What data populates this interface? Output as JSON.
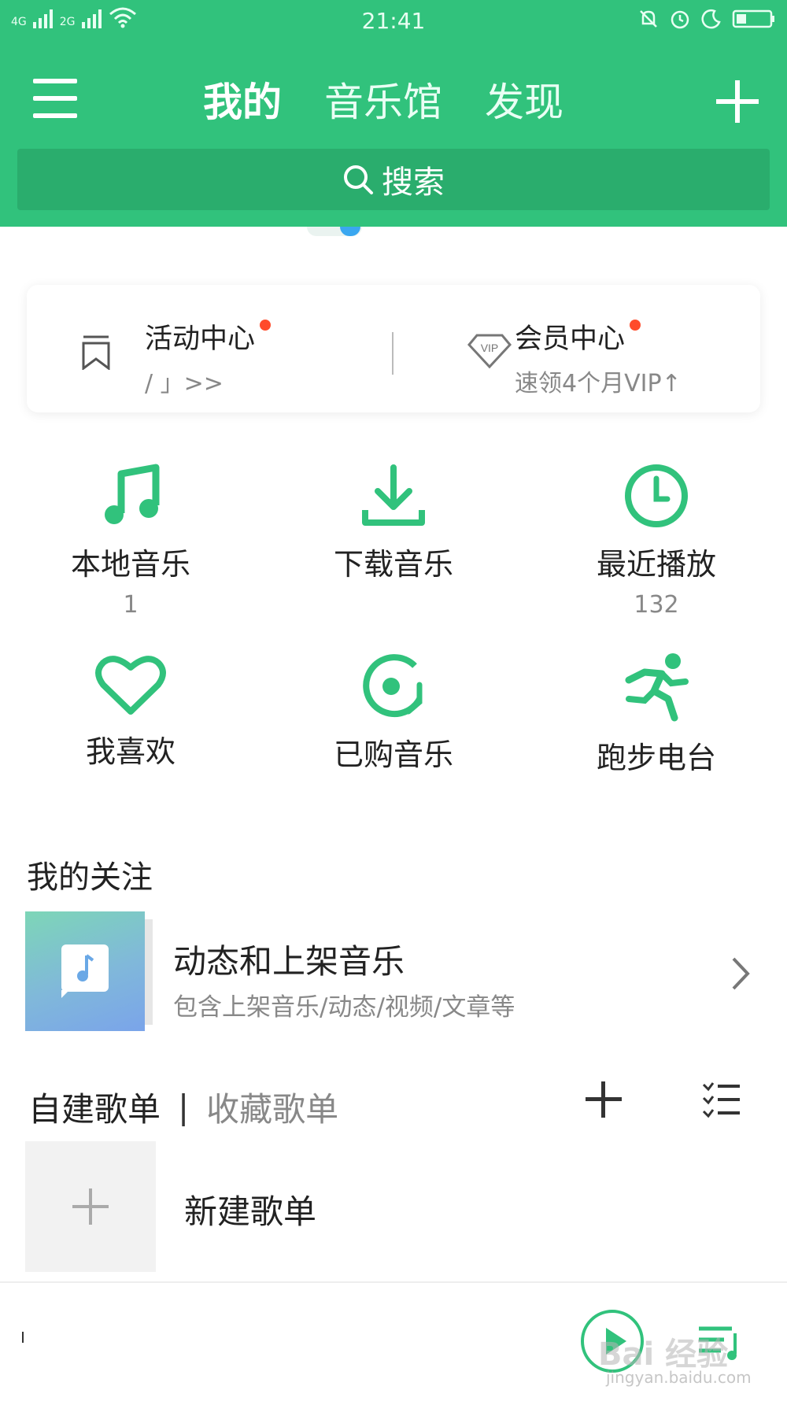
{
  "status_bar": {
    "network1": "4G",
    "network2": "2G",
    "time": "21:41"
  },
  "header": {
    "tabs": [
      {
        "label": "我的",
        "active": true
      },
      {
        "label": "音乐馆",
        "active": false
      },
      {
        "label": "发现",
        "active": false
      }
    ],
    "search_label": "搜索"
  },
  "promo_card": {
    "activity": {
      "title": "活动中心",
      "subtitle": "/ 」>>"
    },
    "vip": {
      "title": "会员中心",
      "subtitle": "速领4个月VIP↑",
      "icon_text": "VIP"
    }
  },
  "quick_grid": [
    {
      "label": "本地音乐",
      "count": "1",
      "icon": "music-note-icon"
    },
    {
      "label": "下载音乐",
      "count": "",
      "icon": "download-icon"
    },
    {
      "label": "最近播放",
      "count": "132",
      "icon": "clock-icon"
    },
    {
      "label": "我喜欢",
      "count": "",
      "icon": "heart-icon"
    },
    {
      "label": "已购音乐",
      "count": "",
      "icon": "purchased-disc-icon"
    },
    {
      "label": "跑步电台",
      "count": "",
      "icon": "running-icon"
    }
  ],
  "follow_section": {
    "title": "我的关注",
    "item": {
      "title": "动态和上架音乐",
      "subtitle": "包含上架音乐/动态/视频/文章等"
    }
  },
  "playlists": {
    "tab_created": "自建歌单",
    "separator": "|",
    "tab_collected": "收藏歌单",
    "new_label": "新建歌单"
  },
  "watermark": {
    "text": "Bai 经验",
    "sub": "jingyan.baidu.com"
  },
  "colors": {
    "accent": "#31c27c",
    "search_bg": "#2aad6d",
    "red_dot": "#ff4b2b"
  }
}
